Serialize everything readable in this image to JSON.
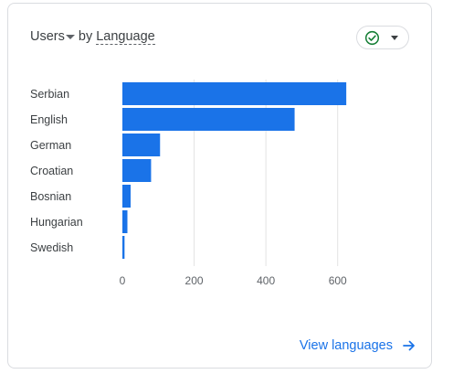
{
  "card": {
    "metric_label": "Users",
    "by_label": "by",
    "dimension_label": "Language",
    "status_icon": "check-circle-icon",
    "status_color": "#188038",
    "footer_link": "View languages",
    "footer_icon": "arrow-right-icon",
    "accent_color": "#1a73e8"
  },
  "chart_data": {
    "type": "bar",
    "orientation": "horizontal",
    "categories": [
      "Serbian",
      "English",
      "German",
      "Croatian",
      "Bosnian",
      "Hungarian",
      "Swedish"
    ],
    "values": [
      624,
      480,
      105,
      80,
      23,
      14,
      6
    ],
    "xlim": [
      0,
      700
    ],
    "xticks": [
      0,
      200,
      400,
      600
    ],
    "xtick_labels": [
      "0",
      "200",
      "400",
      "600"
    ],
    "grid": true,
    "bar_color": "#1a73e8",
    "title": "",
    "xlabel": "",
    "ylabel": ""
  }
}
